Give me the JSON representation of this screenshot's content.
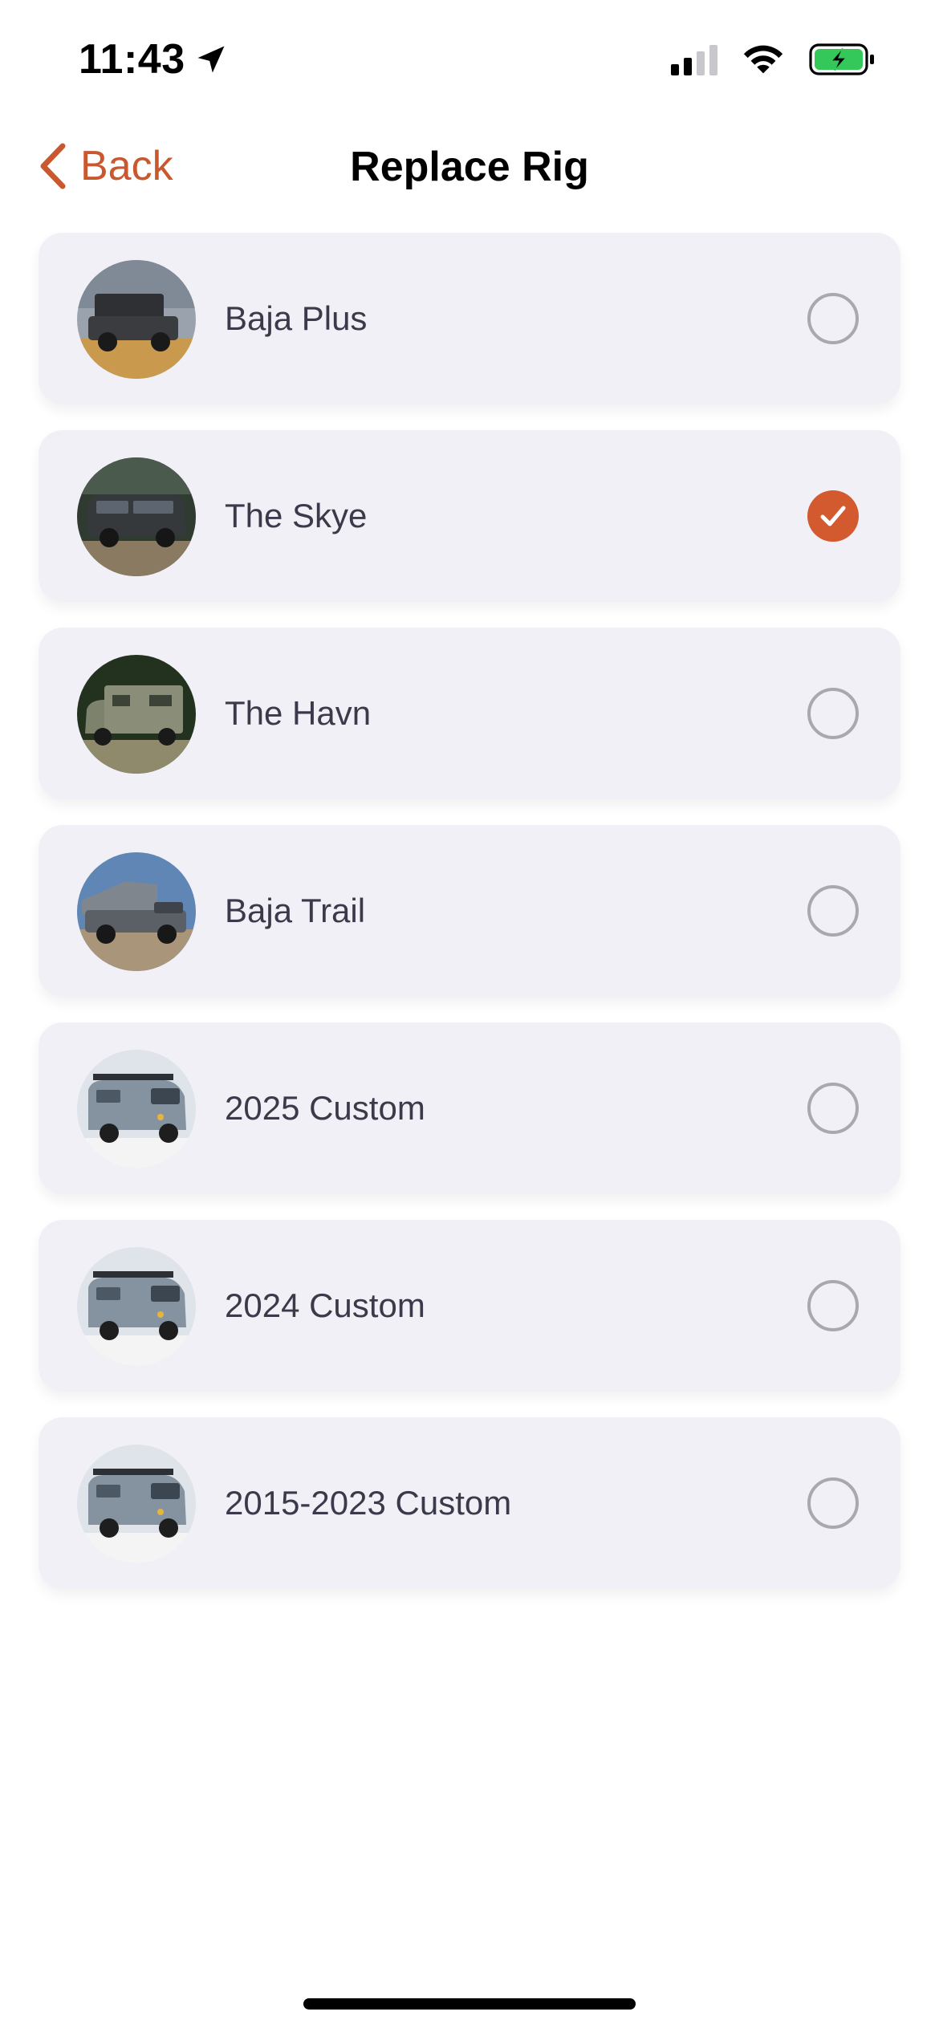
{
  "status_bar": {
    "time": "11:43",
    "icons": [
      "location-arrow-icon",
      "signal-icon",
      "wifi-icon",
      "battery-charging-icon"
    ]
  },
  "nav": {
    "back_label": "Back",
    "title": "Replace Rig"
  },
  "colors": {
    "accent": "#d3592f",
    "card_background": "#f1f0f6",
    "radio_border": "#a9a8b1",
    "text": "#3b3a4a"
  },
  "rigs": [
    {
      "name": "Baja Plus",
      "selected": false
    },
    {
      "name": "The Skye",
      "selected": true
    },
    {
      "name": "The Havn",
      "selected": false
    },
    {
      "name": "Baja Trail",
      "selected": false
    },
    {
      "name": "2025 Custom",
      "selected": false
    },
    {
      "name": "2024 Custom",
      "selected": false
    },
    {
      "name": "2015-2023 Custom",
      "selected": false
    }
  ]
}
